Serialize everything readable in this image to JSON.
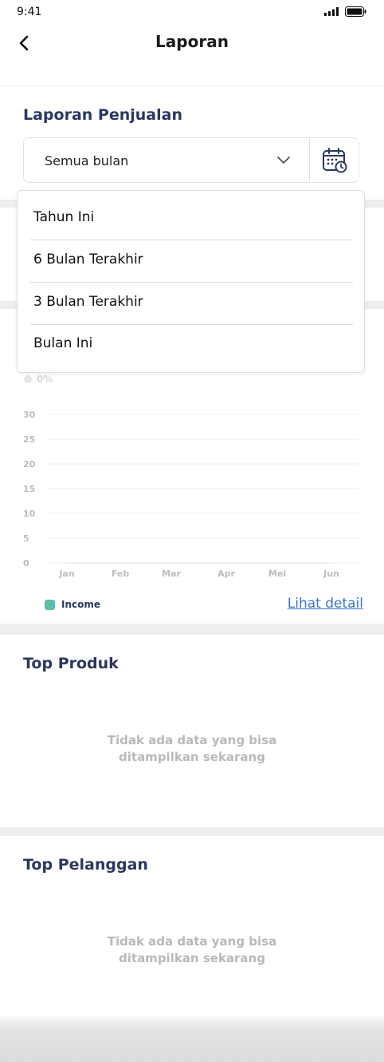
{
  "status_bar": {
    "time": "9:41"
  },
  "header": {
    "title": "Laporan"
  },
  "sales_report": {
    "title": "Laporan Penjualan",
    "month_select": {
      "value": "Semua bulan"
    }
  },
  "dropdown": {
    "options": [
      "Tahun Ini",
      "6 Bulan Terakhir",
      "3 Bulan Terakhir",
      "Bulan Ini"
    ]
  },
  "chart_hint": "0%",
  "chart_data": {
    "type": "line",
    "categories": [
      "Jan",
      "Feb",
      "Mar",
      "Apr",
      "Mei",
      "Jun"
    ],
    "series": [
      {
        "name": "Income",
        "values": [
          0,
          0,
          0,
          0,
          0,
          0
        ]
      }
    ],
    "yticks": [
      0,
      5,
      10,
      15,
      20,
      25,
      30
    ],
    "ylim": [
      0,
      30
    ],
    "grid": true,
    "legend": "bottom-left",
    "colors": {
      "series": "#5cbfa8",
      "grid": "#ededed",
      "ticks": "#bdbdbd"
    }
  },
  "legend": {
    "label": "Income"
  },
  "detail_link": "Lihat detail",
  "top_products": {
    "title": "Top Produk",
    "empty_line1": "Tidak ada data yang bisa",
    "empty_line2": "ditampilkan sekarang"
  },
  "top_customers": {
    "title": "Top Pelanggan",
    "empty_line1": "Tidak ada data yang bisa",
    "empty_line2": "ditampilkan sekarang"
  }
}
